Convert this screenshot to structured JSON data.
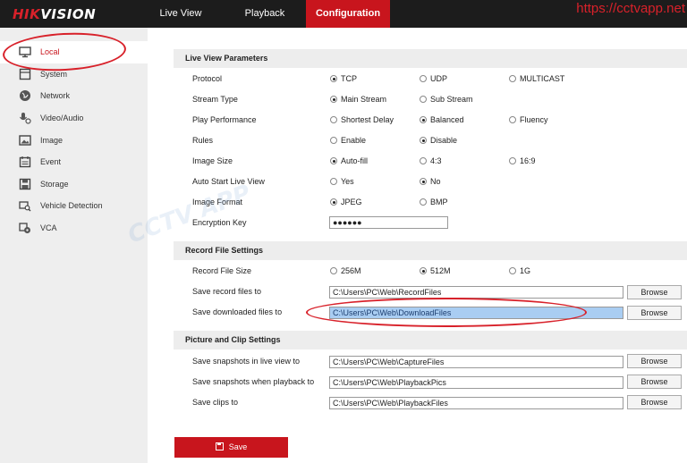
{
  "brand": {
    "logo_hk": "HIK",
    "logo_rest": "VISION",
    "watermark": "https://cctvapp.net",
    "faint_watermark": "CCTV APP"
  },
  "nav": {
    "tabs": [
      {
        "label": "Live View"
      },
      {
        "label": "Playback"
      },
      {
        "label": "Configuration",
        "active": true
      }
    ]
  },
  "sidebar": {
    "items": [
      {
        "label": "Local",
        "icon": "monitor-icon",
        "active": true
      },
      {
        "label": "System",
        "icon": "system-icon"
      },
      {
        "label": "Network",
        "icon": "globe-icon"
      },
      {
        "label": "Video/Audio",
        "icon": "microphone-icon"
      },
      {
        "label": "Image",
        "icon": "image-icon"
      },
      {
        "label": "Event",
        "icon": "calendar-icon"
      },
      {
        "label": "Storage",
        "icon": "storage-icon"
      },
      {
        "label": "Vehicle Detection",
        "icon": "vehicle-search-icon"
      },
      {
        "label": "VCA",
        "icon": "vca-icon"
      }
    ]
  },
  "live_view": {
    "title": "Live View Parameters",
    "rows": [
      {
        "label": "Protocol",
        "options": [
          "TCP",
          "UDP",
          "MULTICAST"
        ],
        "selected": 0
      },
      {
        "label": "Stream Type",
        "options": [
          "Main Stream",
          "Sub Stream"
        ],
        "selected": 0
      },
      {
        "label": "Play Performance",
        "options": [
          "Shortest Delay",
          "Balanced",
          "Fluency"
        ],
        "selected": 1
      },
      {
        "label": "Rules",
        "options": [
          "Enable",
          "Disable"
        ],
        "selected": 1
      },
      {
        "label": "Image Size",
        "options": [
          "Auto-fill",
          "4:3",
          "16:9"
        ],
        "selected": 0
      },
      {
        "label": "Auto Start Live View",
        "options": [
          "Yes",
          "No"
        ],
        "selected": 1
      },
      {
        "label": "Image Format",
        "options": [
          "JPEG",
          "BMP"
        ],
        "selected": 0
      },
      {
        "label": "Encryption Key",
        "value": "●●●●●●"
      }
    ]
  },
  "record": {
    "title": "Record File Settings",
    "size_label": "Record File Size",
    "size_options": [
      "256M",
      "512M",
      "1G"
    ],
    "size_selected": 1,
    "paths": [
      {
        "label": "Save record files to",
        "value": "C:\\Users\\PC\\Web\\RecordFiles"
      },
      {
        "label": "Save downloaded files to",
        "value": "C:\\Users\\PC\\Web\\DownloadFiles"
      }
    ]
  },
  "picture": {
    "title": "Picture and Clip Settings",
    "paths": [
      {
        "label": "Save snapshots in live view to",
        "value": "C:\\Users\\PC\\Web\\CaptureFiles"
      },
      {
        "label": "Save snapshots when playback to",
        "value": "C:\\Users\\PC\\Web\\PlaybackPics"
      },
      {
        "label": "Save clips to",
        "value": "C:\\Users\\PC\\Web\\PlaybackFiles"
      }
    ]
  },
  "browse_label": "Browse",
  "save_label": "Save"
}
